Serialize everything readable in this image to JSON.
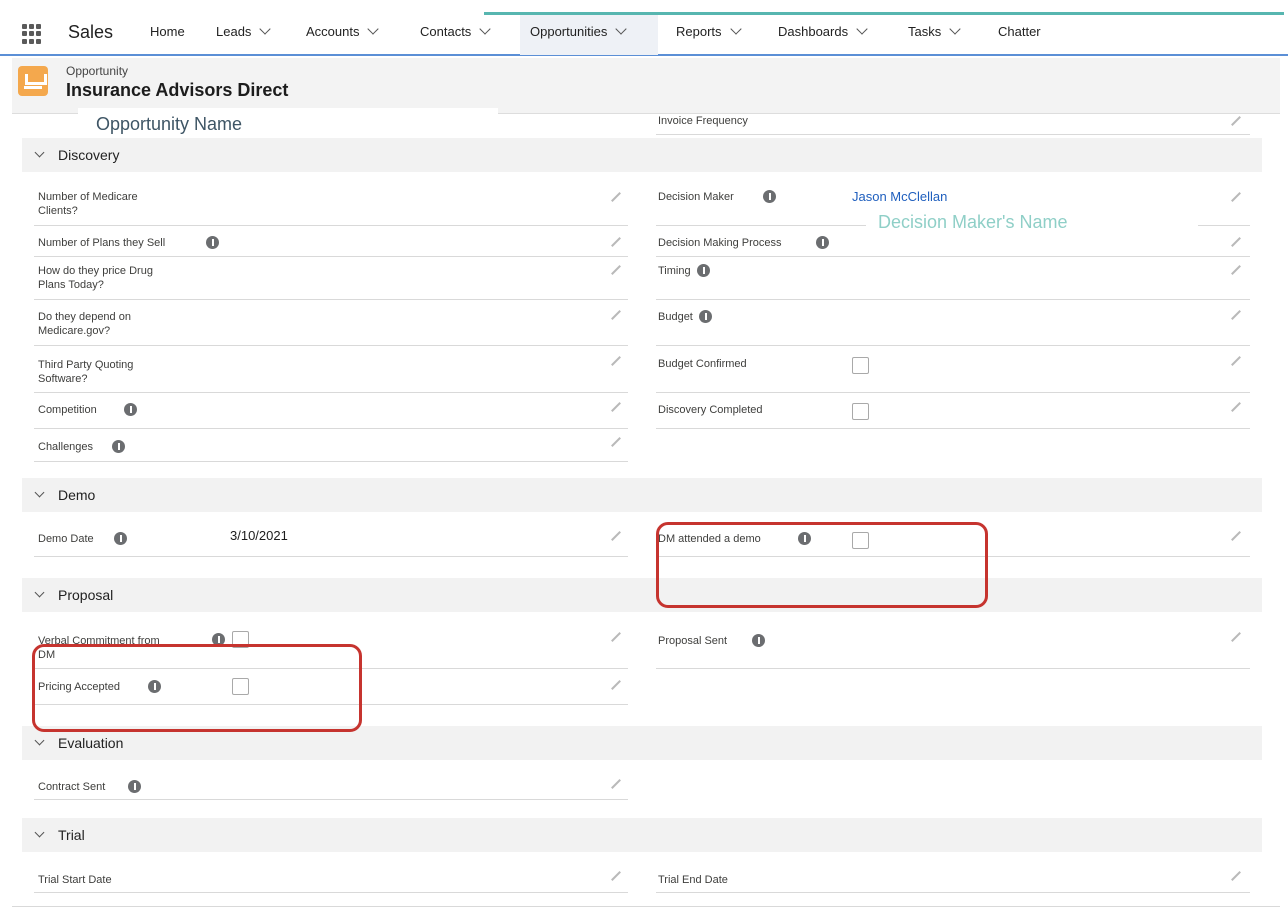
{
  "nav": {
    "app_name": "Sales",
    "items": [
      "Home",
      "Leads",
      "Accounts",
      "Contacts",
      "Opportunities",
      "Reports",
      "Dashboards",
      "Tasks",
      "Chatter"
    ]
  },
  "header": {
    "object_label": "Opportunity",
    "record_name": "Insurance Advisors Direct"
  },
  "annotations": {
    "opportunity_name": "Opportunity Name",
    "decision_maker_name": "Decision Maker's Name"
  },
  "top_fields": {
    "invoice_frequency": "Invoice Frequency"
  },
  "sections": {
    "discovery": "Discovery",
    "demo": "Demo",
    "proposal": "Proposal",
    "evaluation": "Evaluation",
    "trial": "Trial"
  },
  "discovery": {
    "left": [
      {
        "label1": "Number of Medicare",
        "label2": "Clients?"
      },
      {
        "label1": "Number of Plans they Sell",
        "label2": ""
      },
      {
        "label1": "How do they price Drug",
        "label2": "Plans Today?"
      },
      {
        "label1": "Do they depend on",
        "label2": "Medicare.gov?"
      },
      {
        "label1": "Third Party Quoting",
        "label2": "Software?"
      },
      {
        "label1": "Competition",
        "label2": ""
      },
      {
        "label1": "Challenges",
        "label2": ""
      }
    ],
    "right": [
      {
        "label": "Decision Maker",
        "value": "Jason McClellan"
      },
      {
        "label": "Decision Making Process",
        "value": ""
      },
      {
        "label": "Timing",
        "value": ""
      },
      {
        "label": "Budget",
        "value": ""
      },
      {
        "label": "Budget Confirmed",
        "value": ""
      },
      {
        "label": "Discovery Completed",
        "value": ""
      }
    ]
  },
  "demo": {
    "demo_date_label": "Demo Date",
    "demo_date_value": "3/10/2021",
    "dm_attended_label": "DM attended a demo"
  },
  "proposal": {
    "verbal_commitment_label1": "Verbal Commitment from",
    "verbal_commitment_label2": "DM",
    "pricing_accepted_label": "Pricing Accepted",
    "proposal_sent_label": "Proposal Sent"
  },
  "evaluation": {
    "contract_sent_label": "Contract Sent"
  },
  "trial": {
    "trial_start_label": "Trial Start Date",
    "trial_end_label": "Trial End Date"
  }
}
